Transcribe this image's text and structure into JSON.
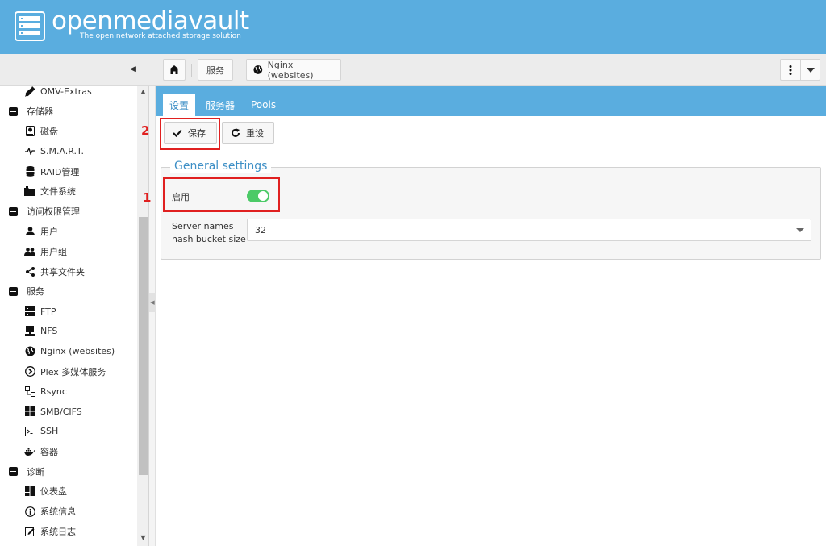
{
  "header": {
    "logo_text": "openmediavault",
    "logo_subtitle": "The open network attached storage solution",
    "bg_color": "#5aaddf"
  },
  "breadcrumb": {
    "home_icon": "home-icon",
    "services": "服务",
    "current": "Nginx (websites)",
    "current_icon": "globe-icon"
  },
  "sidebar": {
    "items": [
      {
        "label": "OMV-Extras",
        "level": "child",
        "icon": "plug-icon"
      },
      {
        "label": "存储器",
        "level": "group",
        "icon": "collapse-icon"
      },
      {
        "label": "磁盘",
        "level": "child",
        "icon": "disk-icon"
      },
      {
        "label": "S.M.A.R.T.",
        "level": "child",
        "icon": "pulse-icon"
      },
      {
        "label": "RAID管理",
        "level": "child",
        "icon": "database-icon"
      },
      {
        "label": "文件系统",
        "level": "child",
        "icon": "folders-icon"
      },
      {
        "label": "访问权限管理",
        "level": "group",
        "icon": "collapse-icon"
      },
      {
        "label": "用户",
        "level": "child",
        "icon": "user-icon"
      },
      {
        "label": "用户组",
        "level": "child",
        "icon": "users-icon"
      },
      {
        "label": "共享文件夹",
        "level": "child",
        "icon": "share-icon"
      },
      {
        "label": "服务",
        "level": "group",
        "icon": "collapse-icon"
      },
      {
        "label": "FTP",
        "level": "child",
        "icon": "server-icon"
      },
      {
        "label": "NFS",
        "level": "child",
        "icon": "network-drive-icon"
      },
      {
        "label": "Nginx (websites)",
        "level": "child",
        "icon": "globe-icon"
      },
      {
        "label": "Plex 多媒体服务",
        "level": "child",
        "icon": "plex-icon"
      },
      {
        "label": "Rsync",
        "level": "child",
        "icon": "sync-icon"
      },
      {
        "label": "SMB/CIFS",
        "level": "child",
        "icon": "windows-icon"
      },
      {
        "label": "SSH",
        "level": "child",
        "icon": "terminal-icon"
      },
      {
        "label": "容器",
        "level": "child",
        "icon": "docker-icon"
      },
      {
        "label": "诊断",
        "level": "group",
        "icon": "collapse-icon"
      },
      {
        "label": "仪表盘",
        "level": "child",
        "icon": "dashboard-icon"
      },
      {
        "label": "系统信息",
        "level": "child",
        "icon": "info-icon"
      },
      {
        "label": "系统日志",
        "level": "child",
        "icon": "log-icon"
      }
    ]
  },
  "tabs": [
    {
      "label": "设置",
      "active": true
    },
    {
      "label": "服务器",
      "active": false
    },
    {
      "label": "Pools",
      "active": false
    }
  ],
  "actions": {
    "save": "保存",
    "reset": "重设"
  },
  "annotations": {
    "step1": "1",
    "step2": "2",
    "color": "#e02020"
  },
  "form": {
    "legend": "General settings",
    "enable_label": "启用",
    "enable_value": true,
    "hash_label": "Server names hash bucket size",
    "hash_value": "32"
  }
}
